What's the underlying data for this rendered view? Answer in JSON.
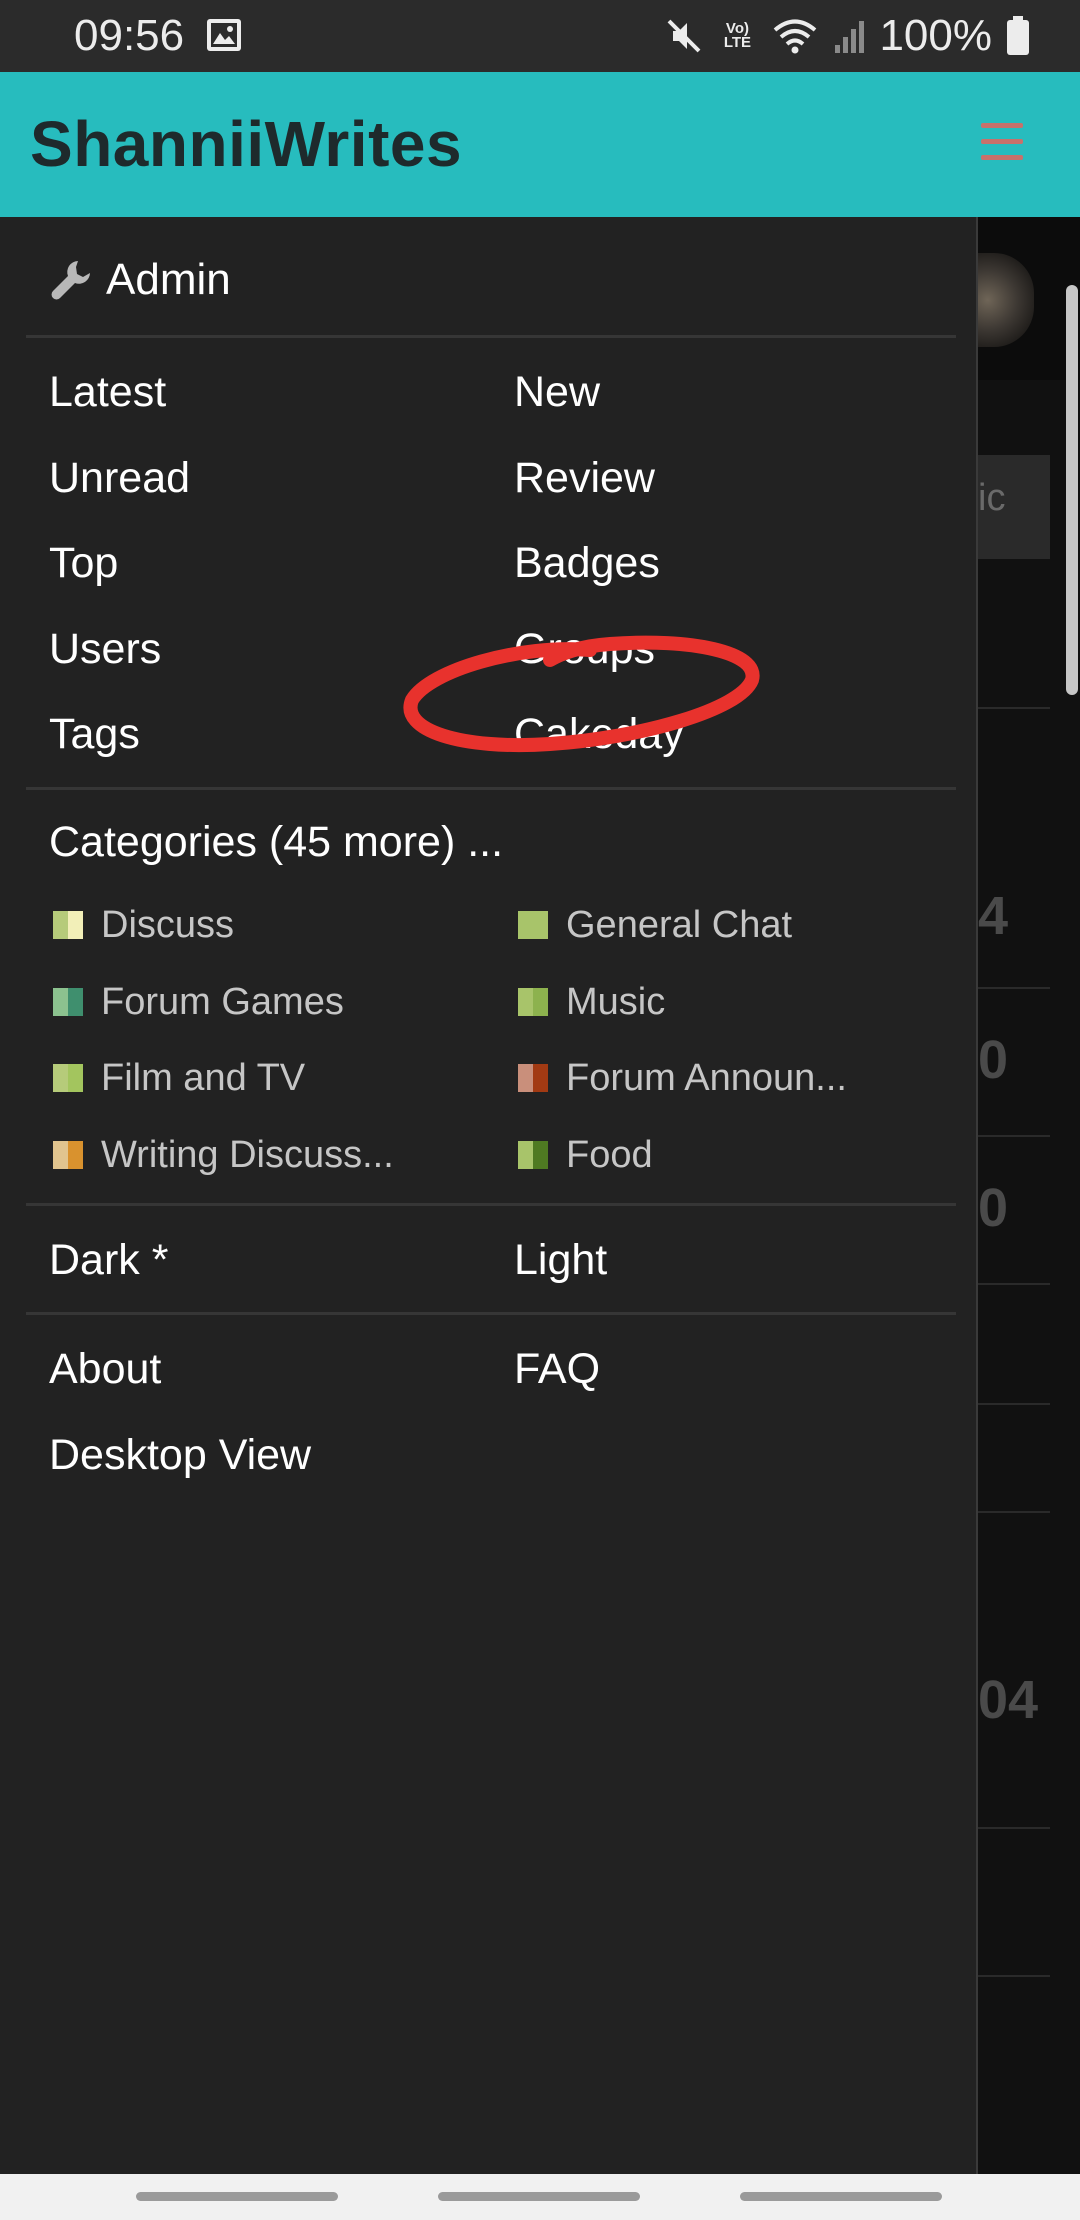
{
  "status_bar": {
    "time": "09:56",
    "battery_text": "100%",
    "lte_top": "Vo)",
    "lte_bottom": "LTE"
  },
  "header": {
    "title": "ShanniiWrites"
  },
  "drawer": {
    "admin_label": "Admin",
    "nav_left": [
      "Latest",
      "Unread",
      "Top",
      "Users",
      "Tags"
    ],
    "nav_right": [
      "New",
      "Review",
      "Badges",
      "Groups",
      "Cakeday"
    ],
    "categories_heading": "Categories (45 more) ...",
    "categories": [
      {
        "label": "Discuss",
        "colors": [
          "#b6cb7a",
          "#f2efb8"
        ]
      },
      {
        "label": "General Chat",
        "colors": [
          "#a8c46a",
          "#a8c46a"
        ]
      },
      {
        "label": "Forum Games",
        "colors": [
          "#8cc28f",
          "#3f8f6e"
        ]
      },
      {
        "label": "Music",
        "colors": [
          "#a8c46a",
          "#8db24e"
        ]
      },
      {
        "label": "Film and TV",
        "colors": [
          "#b6cb7a",
          "#a3c55e"
        ]
      },
      {
        "label": "Forum Announ...",
        "colors": [
          "#c98f7b",
          "#a23a13"
        ]
      },
      {
        "label": "Writing Discuss...",
        "colors": [
          "#e1c48e",
          "#d9922e"
        ]
      },
      {
        "label": "Food",
        "colors": [
          "#a8c46a",
          "#4f7a22"
        ]
      }
    ],
    "theme_dark": "Dark *",
    "theme_light": "Light",
    "about": "About",
    "faq": "FAQ",
    "desktop_view": "Desktop View",
    "annotation_color": "#e8322d"
  },
  "background_page": {
    "button_fragment": "ic",
    "numbers": [
      "4",
      "0",
      "0",
      "04"
    ]
  },
  "colors": {
    "header_bg": "#27bcbe",
    "drawer_bg": "#222222",
    "hamburger": "#c8716b"
  }
}
